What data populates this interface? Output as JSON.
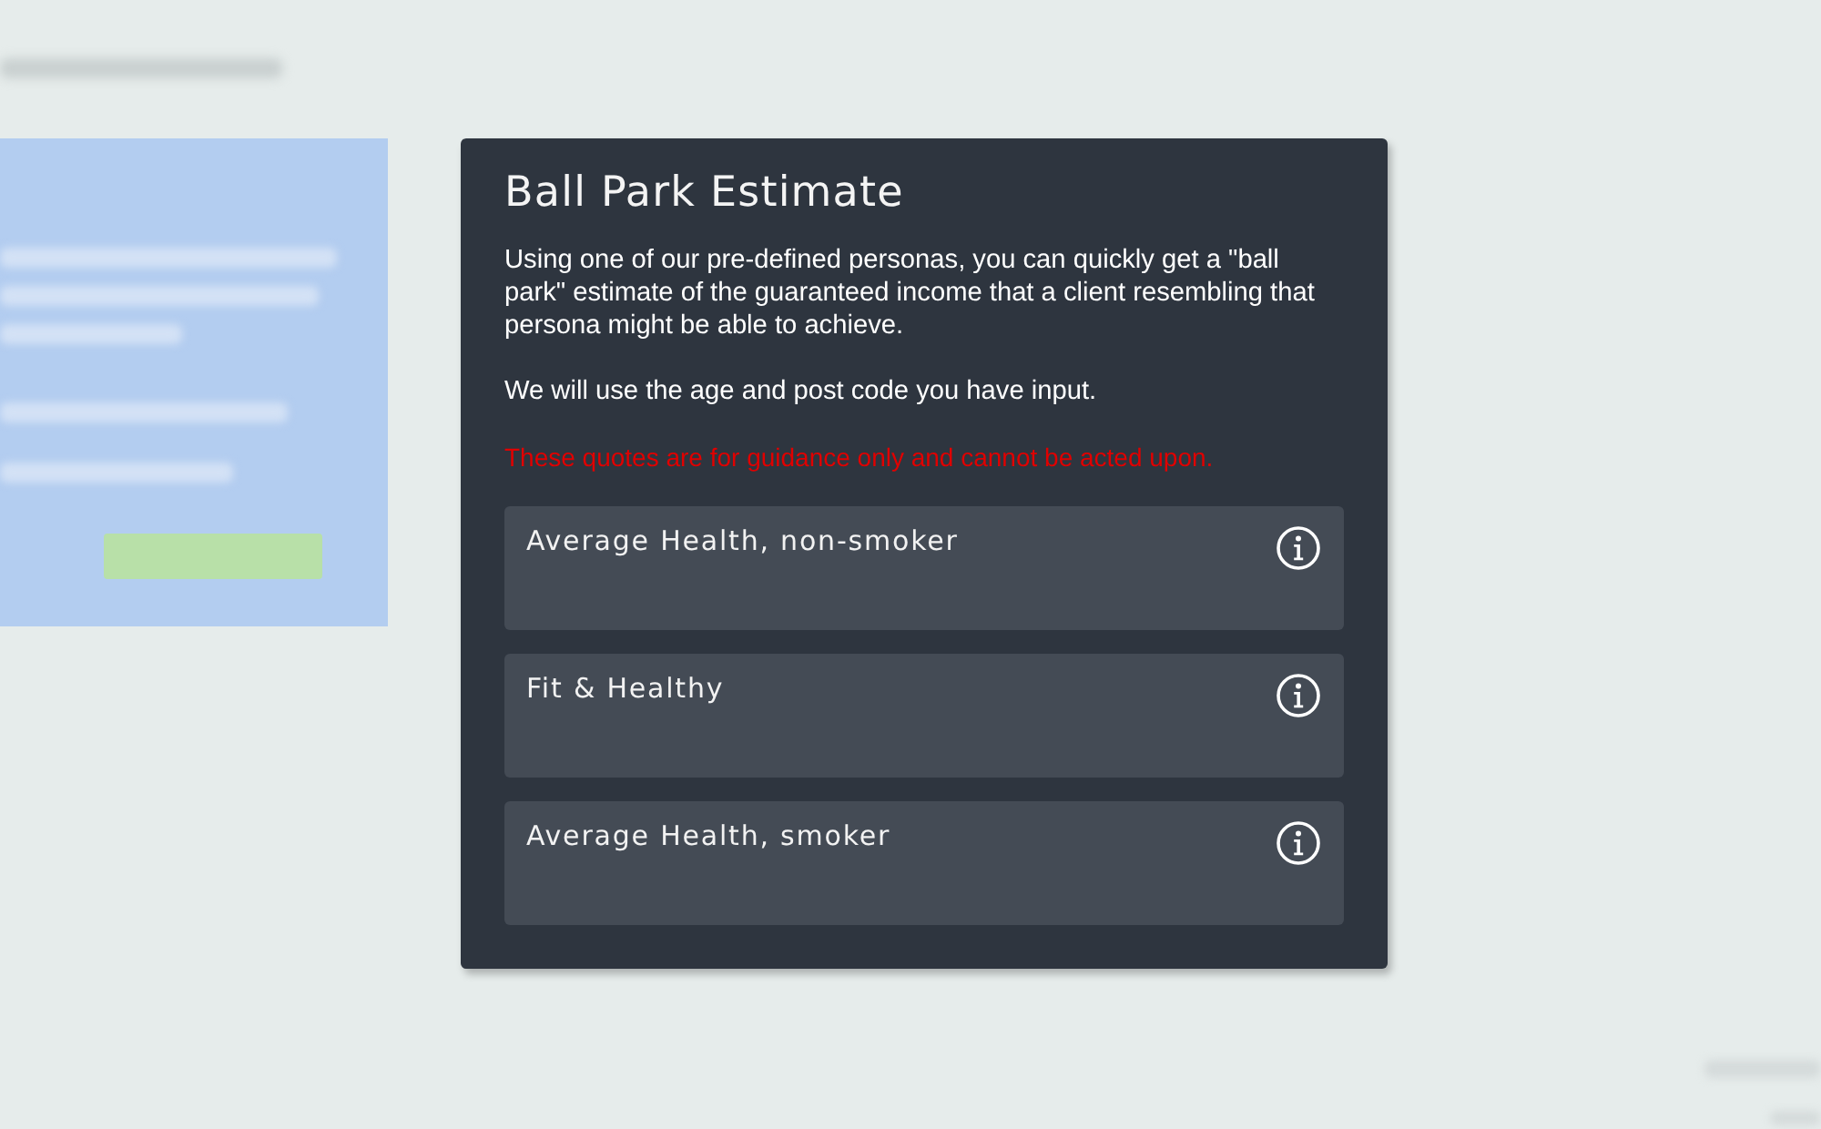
{
  "dialog": {
    "title": "Ball Park Estimate",
    "paragraphs": [
      "Using one of our pre-defined personas, you can quickly get a \"ball park\" estimate of the guaranteed income that a client resembling that persona might be able to achieve.",
      "We will use the age and post code you have input."
    ],
    "warning": "These quotes are for guidance only and cannot be acted upon.",
    "personas": [
      {
        "label": "Average Health, non-smoker"
      },
      {
        "label": "Fit & Healthy"
      },
      {
        "label": "Average Health, smoker"
      }
    ]
  }
}
